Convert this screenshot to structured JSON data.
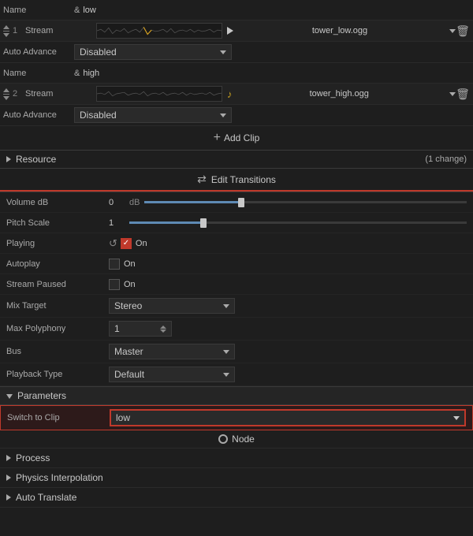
{
  "clips": [
    {
      "index": null,
      "rows": [
        {
          "type": "name",
          "label": "Name",
          "ampersand": "&",
          "value": "low"
        },
        {
          "type": "stream",
          "number": "1",
          "label": "Stream",
          "filename": "tower_low.ogg"
        },
        {
          "type": "advance",
          "label": "Auto Advance",
          "value": "Disabled"
        }
      ]
    },
    {
      "index": null,
      "rows": [
        {
          "type": "name",
          "label": "Name",
          "ampersand": "&",
          "value": "high"
        },
        {
          "type": "stream",
          "number": "2",
          "label": "Stream",
          "filename": "tower_high.ogg"
        },
        {
          "type": "advance",
          "label": "Auto Advance",
          "value": "Disabled"
        }
      ]
    }
  ],
  "add_clip_label": "Add Clip",
  "resource_label": "Resource",
  "resource_change": "(1 change)",
  "edit_transitions_label": "Edit Transitions",
  "properties": [
    {
      "label": "Volume dB",
      "value": "0",
      "unit": "dB",
      "type": "slider",
      "fill_pct": 30
    },
    {
      "label": "Pitch Scale",
      "value": "1",
      "unit": "",
      "type": "slider",
      "fill_pct": 22
    },
    {
      "label": "Playing",
      "value": "On",
      "type": "checkbox_checked"
    },
    {
      "label": "Autoplay",
      "value": "On",
      "type": "checkbox_unchecked"
    },
    {
      "label": "Stream Paused",
      "value": "On",
      "type": "checkbox_unchecked"
    },
    {
      "label": "Mix Target",
      "value": "Stereo",
      "type": "dropdown"
    },
    {
      "label": "Max Polyphony",
      "value": "1",
      "type": "stepper"
    },
    {
      "label": "Bus",
      "value": "Master",
      "type": "dropdown"
    },
    {
      "label": "Playback Type",
      "value": "Default",
      "type": "dropdown"
    }
  ],
  "parameters_label": "Parameters",
  "switch_label": "Switch to Clip",
  "switch_value": "low",
  "node_label": "Node",
  "bottom_sections": [
    {
      "label": "Process"
    },
    {
      "label": "Physics Interpolation"
    },
    {
      "label": "Auto Translate"
    }
  ]
}
